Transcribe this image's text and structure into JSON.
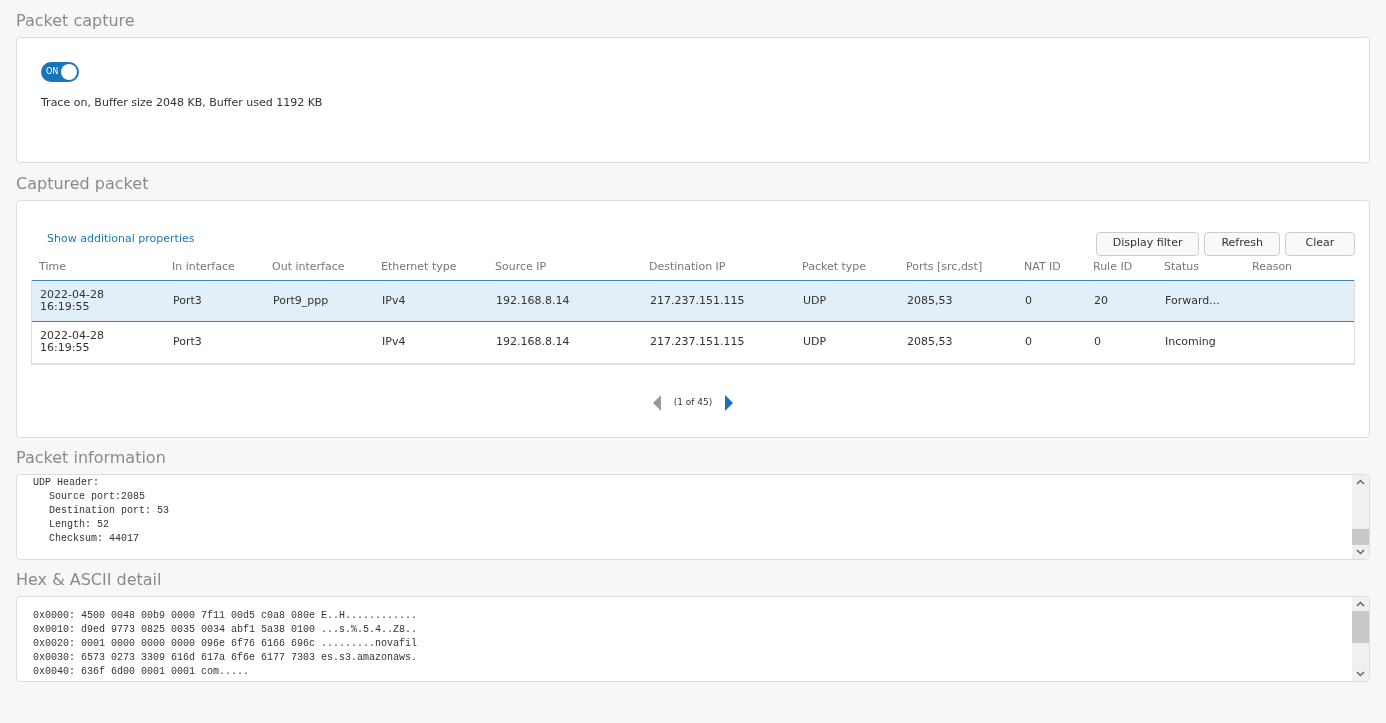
{
  "packet_capture": {
    "title": "Packet capture",
    "toggle": {
      "label": "ON",
      "on": true
    },
    "status_text": "Trace on, Buffer size 2048 KB, Buffer used 1192 KB"
  },
  "captured_packet": {
    "title": "Captured packet",
    "link": "Show additional properties",
    "buttons": [
      "Display filter",
      "Refresh",
      "Clear"
    ],
    "table": {
      "columns": [
        "Time",
        "In interface",
        "Out interface",
        "Ethernet type",
        "Source IP",
        "Destination IP",
        "Packet type",
        "Ports [src,dst]",
        "NAT ID",
        "Rule ID",
        "Status",
        "Reason"
      ],
      "rows": [
        {
          "selected": true,
          "cells": [
            "2022-04-28 16:19:55",
            "Port3",
            "Port9_ppp",
            "IPv4",
            "192.168.8.14",
            "217.237.151.115",
            "UDP",
            "2085,53",
            "0",
            "20",
            "Forward...",
            ""
          ]
        },
        {
          "selected": false,
          "cells": [
            "2022-04-28 16:19:55",
            "Port3",
            "",
            "IPv4",
            "192.168.8.14",
            "217.237.151.115",
            "UDP",
            "2085,53",
            "0",
            "0",
            "Incoming",
            ""
          ]
        }
      ]
    },
    "pagination": "(1 of 45)"
  },
  "packet_information": {
    "title": "Packet information",
    "lines": [
      {
        "text": "UDP Header:",
        "children": [
          {
            "text": "Source port:2085"
          },
          {
            "text": "Destination port: 53"
          },
          {
            "text": "Length: 52"
          },
          {
            "text": "Checksum: 44017"
          }
        ]
      }
    ]
  },
  "hex_detail": {
    "title": "Hex & ASCII detail",
    "lines": [
      "0x0000: 4500 0048 00b9 0000 7f11 00d5 c0a8 080e E..H............",
      "0x0010: d9ed 9773 0825 0035 0034 abf1 5a38 0100 ...s.%.5.4..Z8..",
      "0x0020: 0001 0000 0000 0000 096e 6f76 6166 696c .........novafil",
      "0x0030: 6573 0273 3309 616d 617a 6f6e 6177 7303 es.s3.amazonaws.",
      "0x0040: 636f 6d00 0001 0001 com....."
    ]
  }
}
